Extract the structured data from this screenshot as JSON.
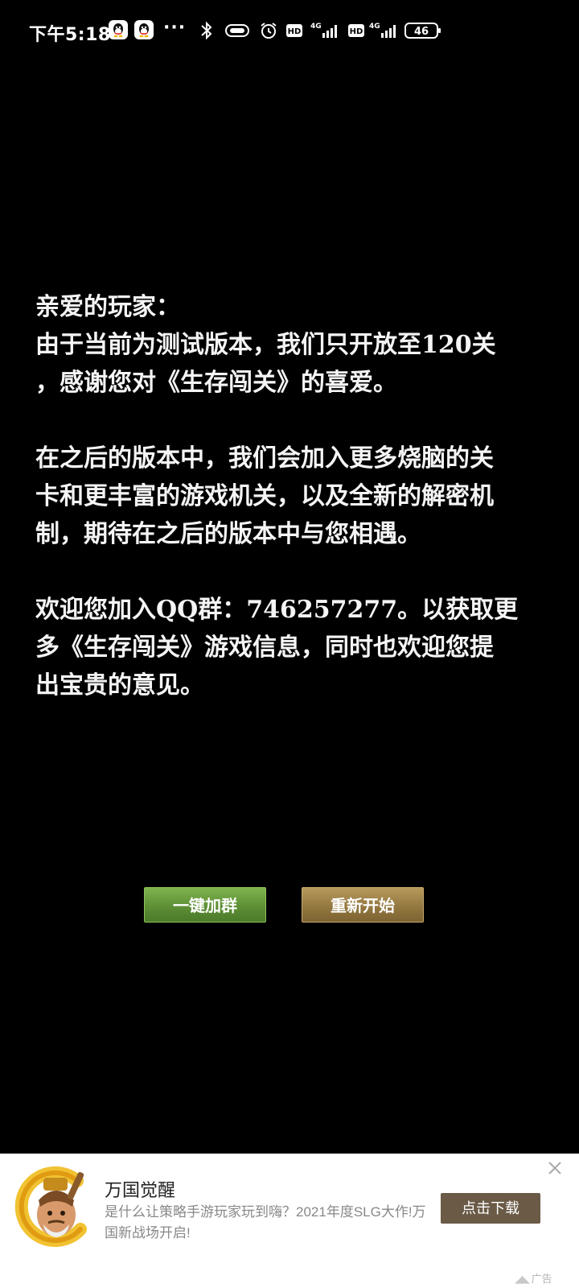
{
  "status_bar": {
    "time": "下午5:18",
    "notification_icons": [
      "qq-icon",
      "qq-icon"
    ],
    "more_indicator": "···",
    "hd_label_1": "HD",
    "hd_label_2": "HD",
    "network_1": "4G",
    "network_2": "4G",
    "battery_level": "46"
  },
  "message": {
    "paragraphs": [
      "亲爱的玩家：\n由于当前为测试版本，我们只开放至120关\n，感谢您对《生存闯关》的喜爱。",
      "在之后的版本中，我们会加入更多烧脑的关\n卡和更丰富的游戏机关，以及全新的解密机\n制，期待在之后的版本中与您相遇。",
      "欢迎您加入QQ群：746257277。以获取更\n多《生存闯关》游戏信息，同时也欢迎您提\n出宝贵的意见。"
    ]
  },
  "buttons": {
    "join_group": "一键加群",
    "restart": "重新开始"
  },
  "ad": {
    "title": "万国觉醒",
    "description": "是什么让策略手游玩家玩到嗨？2021年度SLG大作!万国新战场开启!",
    "cta": "点击下载",
    "ad_label": "广告"
  },
  "colors": {
    "background": "#000000",
    "join_button": "#5d8f35",
    "restart_button": "#947840",
    "ad_cta": "#6a5a46"
  }
}
